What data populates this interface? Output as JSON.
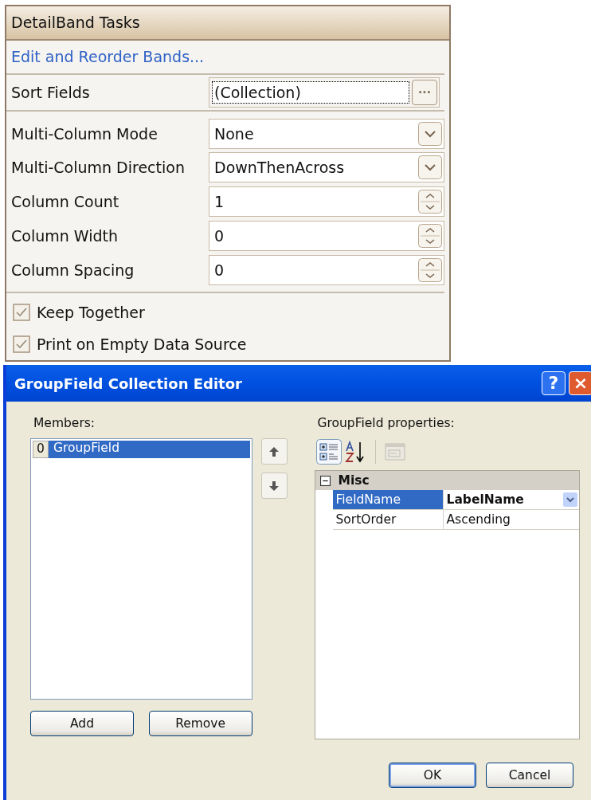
{
  "tasks_panel": {
    "title": "DetailBand Tasks",
    "link": "Edit and Reorder Bands...",
    "fields": [
      {
        "label": "Sort Fields",
        "value": "(Collection)",
        "kind": "ellipsis",
        "focused": true,
        "button": "···"
      },
      {
        "label": "Multi-Column Mode",
        "value": "None",
        "kind": "dropdown",
        "focused": false
      },
      {
        "label": "Multi-Column Direction",
        "value": "DownThenAcross",
        "kind": "dropdown",
        "focused": false
      },
      {
        "label": "Column Count",
        "value": "1",
        "kind": "spinner",
        "focused": false
      },
      {
        "label": "Column Width",
        "value": "0",
        "kind": "spinner",
        "focused": false
      },
      {
        "label": "Column Spacing",
        "value": "0",
        "kind": "spinner",
        "focused": false
      }
    ],
    "checkboxes": [
      {
        "label": "Keep Together",
        "checked": true
      },
      {
        "label": "Print on Empty Data Source",
        "checked": true
      }
    ]
  },
  "dialog": {
    "title": "GroupField Collection Editor",
    "title_buttons": [
      "?",
      "×"
    ],
    "members_label": "Members:",
    "members": [
      {
        "index": "0",
        "name": "GroupField",
        "selected": true
      }
    ],
    "properties_label": "GroupField properties:",
    "toolbar": [
      {
        "kind": "categorized",
        "pressed": true,
        "disabled": false
      },
      {
        "kind": "alphabetical",
        "pressed": false,
        "disabled": false
      },
      {
        "kind": "pages",
        "pressed": false,
        "disabled": true
      }
    ],
    "grid": {
      "category": "Misc",
      "expanded": true,
      "rows": [
        {
          "name": "FieldName",
          "value": "LabelName",
          "selected": true,
          "bold": true
        },
        {
          "name": "SortOrder",
          "value": "Ascending",
          "selected": false,
          "bold": false
        }
      ]
    },
    "list_buttons": [
      "Add",
      "Remove"
    ],
    "buttons": [
      {
        "label": "OK",
        "default": true
      },
      {
        "label": "Cancel",
        "default": false
      }
    ]
  }
}
